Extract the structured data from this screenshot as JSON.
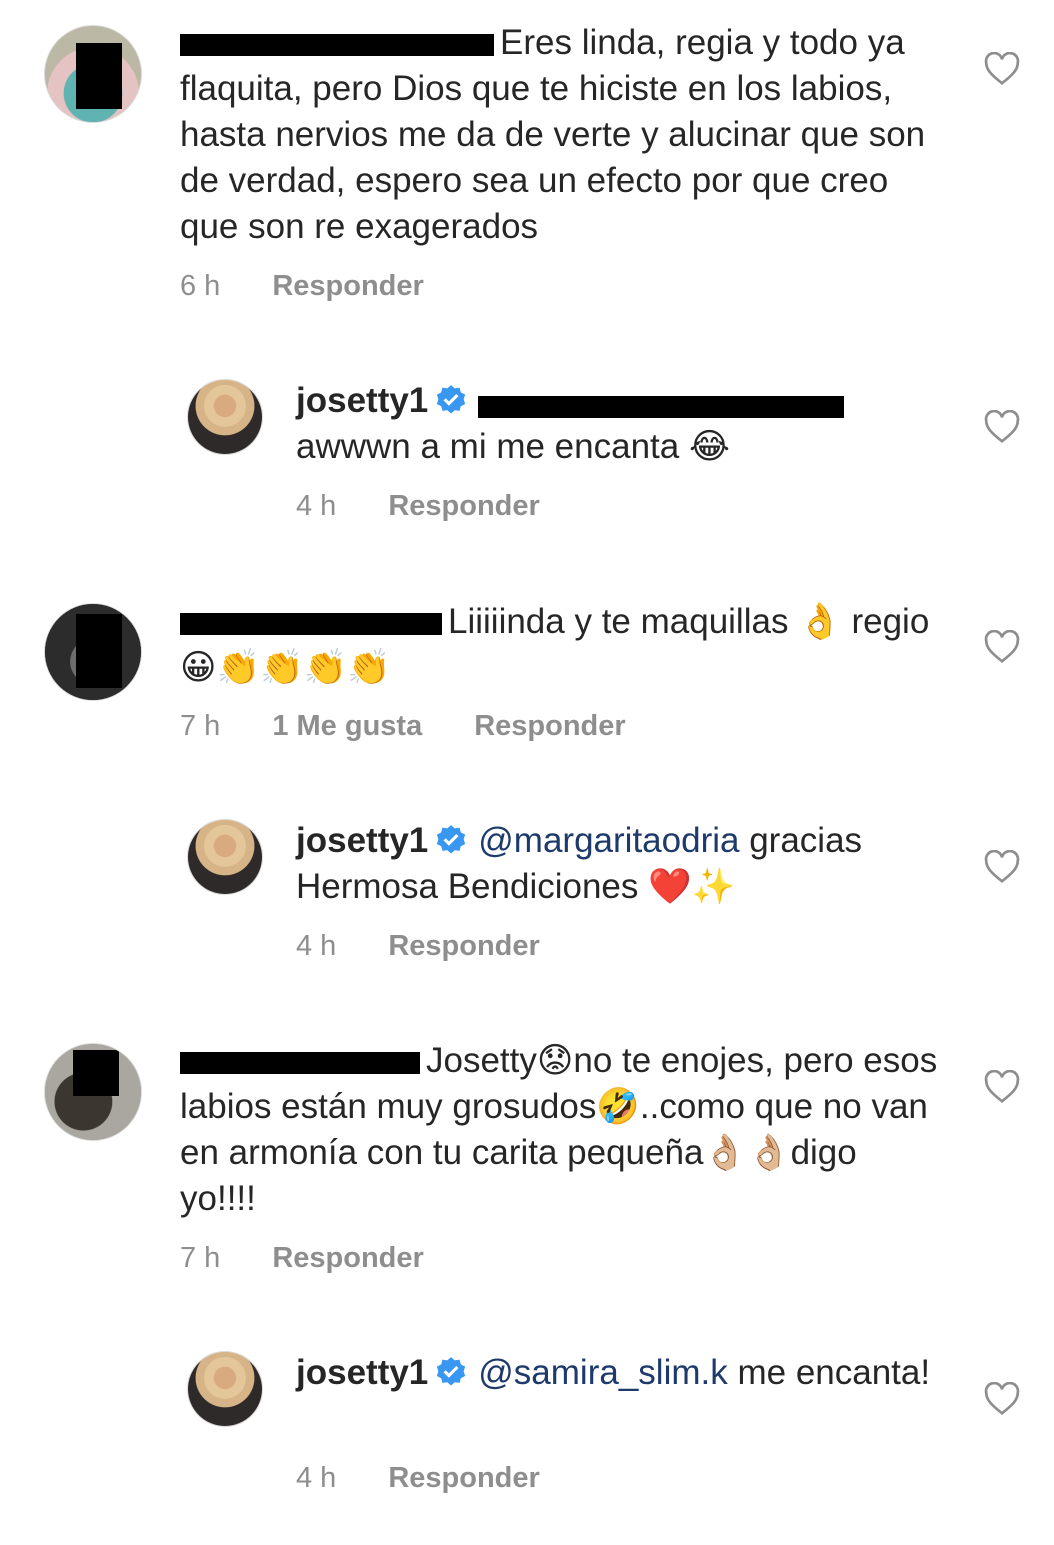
{
  "comments": [
    {
      "text": "Eres linda, regia y todo ya flaquita, pero Dios que te hiciste en los labios, hasta nervios me da de verte y alucinar que son de verdad, espero sea un efecto por que creo que son re exagerados",
      "time": "6 h",
      "reply_label": "Responder"
    },
    {
      "username": "josetty1",
      "text": "awwwn a mi me encanta 😂",
      "time": "4 h",
      "reply_label": "Responder"
    },
    {
      "text": "Liiiiinda y te maquillas 👌 regio 😀👏👏👏👏",
      "time": "7 h",
      "likes": "1 Me gusta",
      "reply_label": "Responder"
    },
    {
      "username": "josetty1",
      "mention": "@margaritaodria",
      "text": "gracias Hermosa Bendiciones ❤️✨",
      "time": "4 h",
      "reply_label": "Responder"
    },
    {
      "text": "Josetty😟no te enojes, pero esos labios están muy grosudos🤣..como que no van en armonía con tu carita pequeña👌🏼👌🏼digo yo!!!!",
      "time": "7 h",
      "reply_label": "Responder"
    },
    {
      "username": "josetty1",
      "mention": "@samira_slim.k",
      "text": "me encanta!",
      "time": "4 h",
      "reply_label": "Responder"
    }
  ],
  "icons": {
    "like": "heart-outline-icon",
    "verified": "verified-badge-icon"
  },
  "colors": {
    "mention": "#1d3a6b",
    "verified": "#3897f0",
    "meta": "#8e8e8e"
  }
}
